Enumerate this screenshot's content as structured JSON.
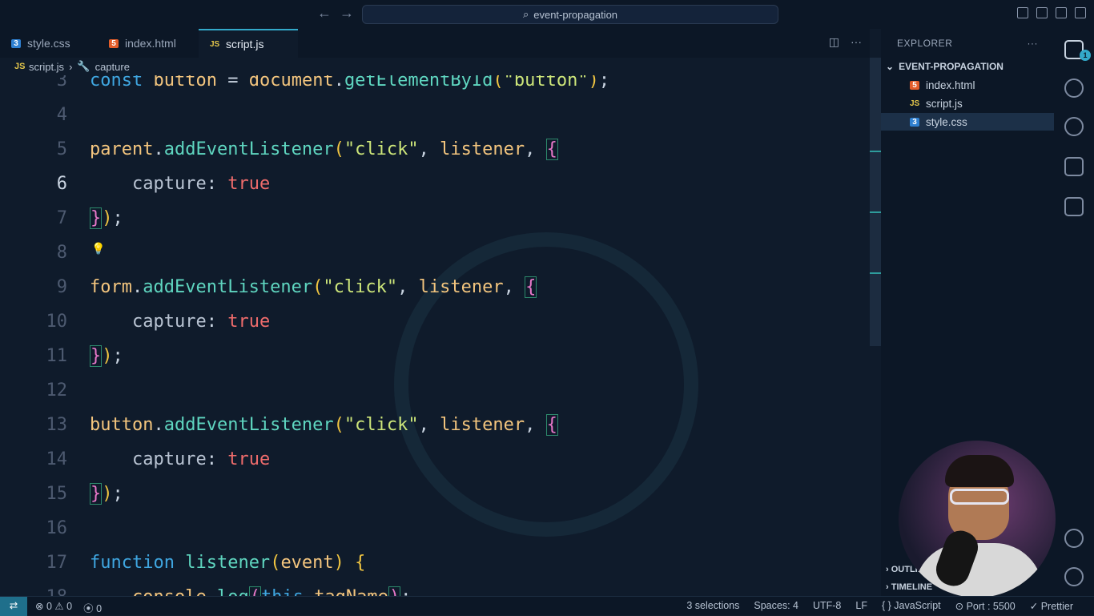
{
  "titlebar": {
    "search_text": "event-propagation"
  },
  "tabs": [
    {
      "label": "style.css",
      "badge": "3",
      "kind": "css"
    },
    {
      "label": "index.html",
      "badge": "5",
      "kind": "html"
    },
    {
      "label": "script.js",
      "badge": "JS",
      "kind": "js",
      "active": true,
      "dirty": true
    }
  ],
  "breadcrumb": {
    "file": "script.js",
    "symbol": "capture",
    "file_badge": "JS"
  },
  "code_lines": [
    {
      "n": "3",
      "parts": [
        [
          "kw",
          "const"
        ],
        [
          "pl",
          " "
        ],
        [
          "var",
          "button"
        ],
        [
          "pl",
          " = "
        ],
        [
          "var",
          "document"
        ],
        [
          "pl",
          "."
        ],
        [
          "fn",
          "getElementById"
        ],
        [
          "br1",
          "("
        ],
        [
          "str",
          "\"button\""
        ],
        [
          "br1",
          ")"
        ],
        [
          "pl",
          ";"
        ]
      ]
    },
    {
      "n": "4",
      "parts": []
    },
    {
      "n": "5",
      "parts": [
        [
          "var",
          "parent"
        ],
        [
          "pl",
          "."
        ],
        [
          "fn",
          "addEventListener"
        ],
        [
          "br1",
          "("
        ],
        [
          "str",
          "\"click\""
        ],
        [
          "pl",
          ", "
        ],
        [
          "var",
          "listener"
        ],
        [
          "pl",
          ", "
        ],
        [
          "br2",
          "{"
        ]
      ]
    },
    {
      "n": "6",
      "parts": [
        [
          "pl",
          "    "
        ],
        [
          "prop",
          "capture"
        ],
        [
          "pl",
          ": "
        ],
        [
          "bool",
          "true"
        ]
      ]
    },
    {
      "n": "7",
      "parts": [
        [
          "br2",
          "}"
        ],
        [
          "br1",
          ")"
        ],
        [
          "pl",
          ";"
        ]
      ]
    },
    {
      "n": "8",
      "parts": []
    },
    {
      "n": "9",
      "parts": [
        [
          "var",
          "form"
        ],
        [
          "pl",
          "."
        ],
        [
          "fn",
          "addEventListener"
        ],
        [
          "br1",
          "("
        ],
        [
          "str",
          "\"click\""
        ],
        [
          "pl",
          ", "
        ],
        [
          "var",
          "listener"
        ],
        [
          "pl",
          ", "
        ],
        [
          "br2",
          "{"
        ]
      ]
    },
    {
      "n": "10",
      "parts": [
        [
          "pl",
          "    "
        ],
        [
          "prop",
          "capture"
        ],
        [
          "pl",
          ": "
        ],
        [
          "bool",
          "true"
        ]
      ]
    },
    {
      "n": "11",
      "parts": [
        [
          "br2",
          "}"
        ],
        [
          "br1",
          ")"
        ],
        [
          "pl",
          ";"
        ]
      ]
    },
    {
      "n": "12",
      "parts": []
    },
    {
      "n": "13",
      "parts": [
        [
          "var",
          "button"
        ],
        [
          "pl",
          "."
        ],
        [
          "fn",
          "addEventListener"
        ],
        [
          "br1",
          "("
        ],
        [
          "str",
          "\"click\""
        ],
        [
          "pl",
          ", "
        ],
        [
          "var",
          "listener"
        ],
        [
          "pl",
          ", "
        ],
        [
          "br2",
          "{"
        ]
      ]
    },
    {
      "n": "14",
      "parts": [
        [
          "pl",
          "    "
        ],
        [
          "prop",
          "capture"
        ],
        [
          "pl",
          ": "
        ],
        [
          "bool",
          "true"
        ]
      ]
    },
    {
      "n": "15",
      "parts": [
        [
          "br2",
          "}"
        ],
        [
          "br1",
          ")"
        ],
        [
          "pl",
          ";"
        ]
      ]
    },
    {
      "n": "16",
      "parts": []
    },
    {
      "n": "17",
      "parts": [
        [
          "kw",
          "function"
        ],
        [
          "pl",
          " "
        ],
        [
          "fn",
          "listener"
        ],
        [
          "br1",
          "("
        ],
        [
          "var",
          "event"
        ],
        [
          "br1",
          ")"
        ],
        [
          "pl",
          " "
        ],
        [
          "br1",
          "{"
        ]
      ]
    },
    {
      "n": "18",
      "parts": [
        [
          "pl",
          "    "
        ],
        [
          "var",
          "console"
        ],
        [
          "pl",
          "."
        ],
        [
          "fn",
          "log"
        ],
        [
          "br2",
          "("
        ],
        [
          "kw",
          "this"
        ],
        [
          "pl",
          "."
        ],
        [
          "var",
          "tagName"
        ],
        [
          "br2",
          ")"
        ],
        [
          "pl",
          ";"
        ]
      ]
    }
  ],
  "explorer": {
    "title": "EXPLORER",
    "folder": "EVENT-PROPAGATION",
    "files": [
      {
        "name": "index.html",
        "badge": "5",
        "kind": "html"
      },
      {
        "name": "script.js",
        "badge": "JS",
        "kind": "js"
      },
      {
        "name": "style.css",
        "badge": "3",
        "kind": "css",
        "selected": true
      }
    ],
    "outline": "OUTLINE",
    "timeline": "TIMELINE"
  },
  "activity": {
    "explorer_badge": "1"
  },
  "status": {
    "errors": "0",
    "warnings": "0",
    "ports": "0",
    "selections": "3 selections",
    "spaces": "Spaces: 4",
    "encoding": "UTF-8",
    "eol": "LF",
    "language": "JavaScript",
    "port": "Port : 5500",
    "formatter": "Prettier"
  }
}
